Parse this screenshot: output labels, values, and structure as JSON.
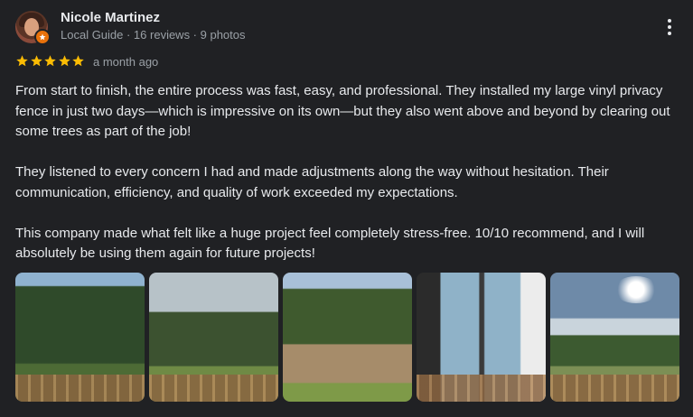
{
  "reviewer": {
    "name": "Nicole Martinez",
    "meta": "Local Guide · 16 reviews · 9 photos"
  },
  "review": {
    "rating": 5,
    "max_rating": 5,
    "date": "a month ago",
    "paragraphs": [
      "From start to finish, the entire process was fast, easy, and professional. They installed my large vinyl privacy fence in just two days—which is impressive on its own—but they also went above and beyond by clearing out some trees as part of the job!",
      "They listened to every concern I had and made adjustments along the way without hesitation. Their communication, efficiency, and quality of work exceeded my expectations.",
      "This company made what felt like a huge project feel completely stress-free. 10/10 recommend, and I will absolutely be using them again for future projects!"
    ]
  },
  "icons": {
    "more": "more-vert-icon",
    "star": "star-icon",
    "badge": "local-guide-badge-icon"
  },
  "colors": {
    "star": "#fbbc04",
    "badge": "#e8710a",
    "background": "#202124"
  }
}
